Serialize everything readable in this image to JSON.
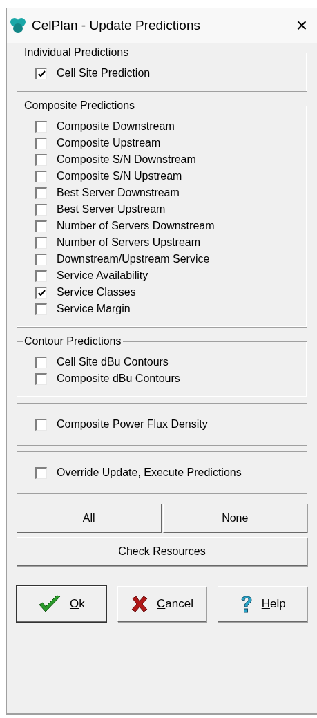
{
  "window": {
    "title": "CelPlan - Update Predictions",
    "close": "×"
  },
  "groups": [
    {
      "kind": "titled",
      "title": "Individual Predictions",
      "items": [
        {
          "label": "Cell Site Prediction",
          "checked": true
        }
      ]
    },
    {
      "kind": "titled",
      "title": "Composite Predictions",
      "items": [
        {
          "label": "Composite Downstream",
          "checked": false
        },
        {
          "label": "Composite Upstream",
          "checked": false
        },
        {
          "label": "Composite S/N Downstream",
          "checked": false
        },
        {
          "label": "Composite S/N Upstream",
          "checked": false
        },
        {
          "label": "Best Server Downstream",
          "checked": false
        },
        {
          "label": "Best Server Upstream",
          "checked": false
        },
        {
          "label": "Number of Servers Downstream",
          "checked": false
        },
        {
          "label": "Number of Servers Upstream",
          "checked": false
        },
        {
          "label": "Downstream/Upstream Service",
          "checked": false
        },
        {
          "label": "Service Availability",
          "checked": false
        },
        {
          "label": "Service Classes",
          "checked": true
        },
        {
          "label": "Service Margin",
          "checked": false
        }
      ]
    },
    {
      "kind": "titled",
      "title": "Contour Predictions",
      "items": [
        {
          "label": "Cell Site dBu Contours",
          "checked": false
        },
        {
          "label": "Composite dBu Contours",
          "checked": false
        }
      ]
    },
    {
      "kind": "plain",
      "items": [
        {
          "label": "Composite Power Flux Density",
          "checked": false
        }
      ]
    },
    {
      "kind": "plain",
      "items": [
        {
          "label": "Override Update, Execute Predictions",
          "checked": false
        }
      ]
    }
  ],
  "select_buttons": [
    "All",
    "None"
  ],
  "check_button": "Check Resources",
  "dialog_buttons": [
    {
      "kind": "ok",
      "accel": "O",
      "rest": "k"
    },
    {
      "kind": "cancel",
      "accel": "C",
      "rest": "ancel"
    },
    {
      "kind": "help",
      "accel": "H",
      "rest": "elp"
    }
  ]
}
